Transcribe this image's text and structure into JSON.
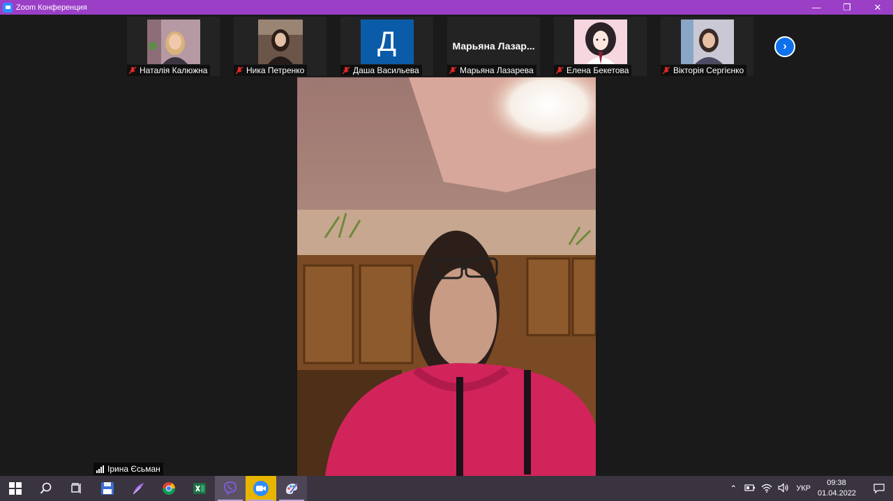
{
  "window": {
    "title": "Zoom Конференция",
    "controls": {
      "minimize": "—",
      "restore": "❐",
      "close": "✕"
    }
  },
  "participants": [
    {
      "name": "Наталія Калюжна",
      "muted": true,
      "video": "photo"
    },
    {
      "name": "Ника Петренко",
      "muted": true,
      "video": "photo"
    },
    {
      "name": "Даша Васильева",
      "muted": true,
      "video": "avatar",
      "avatar_letter": "Д",
      "avatar_color": "#0b5ca8"
    },
    {
      "name": "Марьяна Лазарева",
      "muted": true,
      "video": "off",
      "display_name": "Марьяна  Лазар..."
    },
    {
      "name": "Елена Бекетова",
      "muted": true,
      "video": "photo"
    },
    {
      "name": "Вікторія Сергієнко",
      "muted": true,
      "video": "photo"
    }
  ],
  "strip_next": "›",
  "active_speaker": {
    "name": "Ірина Єсьман"
  },
  "colors": {
    "titlebar": "#9b3fc7",
    "zoom_blue": "#0e71eb",
    "muted_red": "#e02828",
    "taskbar": "#3a3340"
  },
  "taskbar": {
    "icons": [
      "windows-start-icon",
      "search-icon",
      "task-view-icon",
      "save-floppy-icon",
      "feather-app-icon",
      "chrome-icon",
      "excel-icon",
      "viber-icon",
      "zoom-icon",
      "paint-icon"
    ],
    "tray_up": "⌃",
    "language": "УКР",
    "time": "09:38",
    "date": "01.04.2022"
  }
}
